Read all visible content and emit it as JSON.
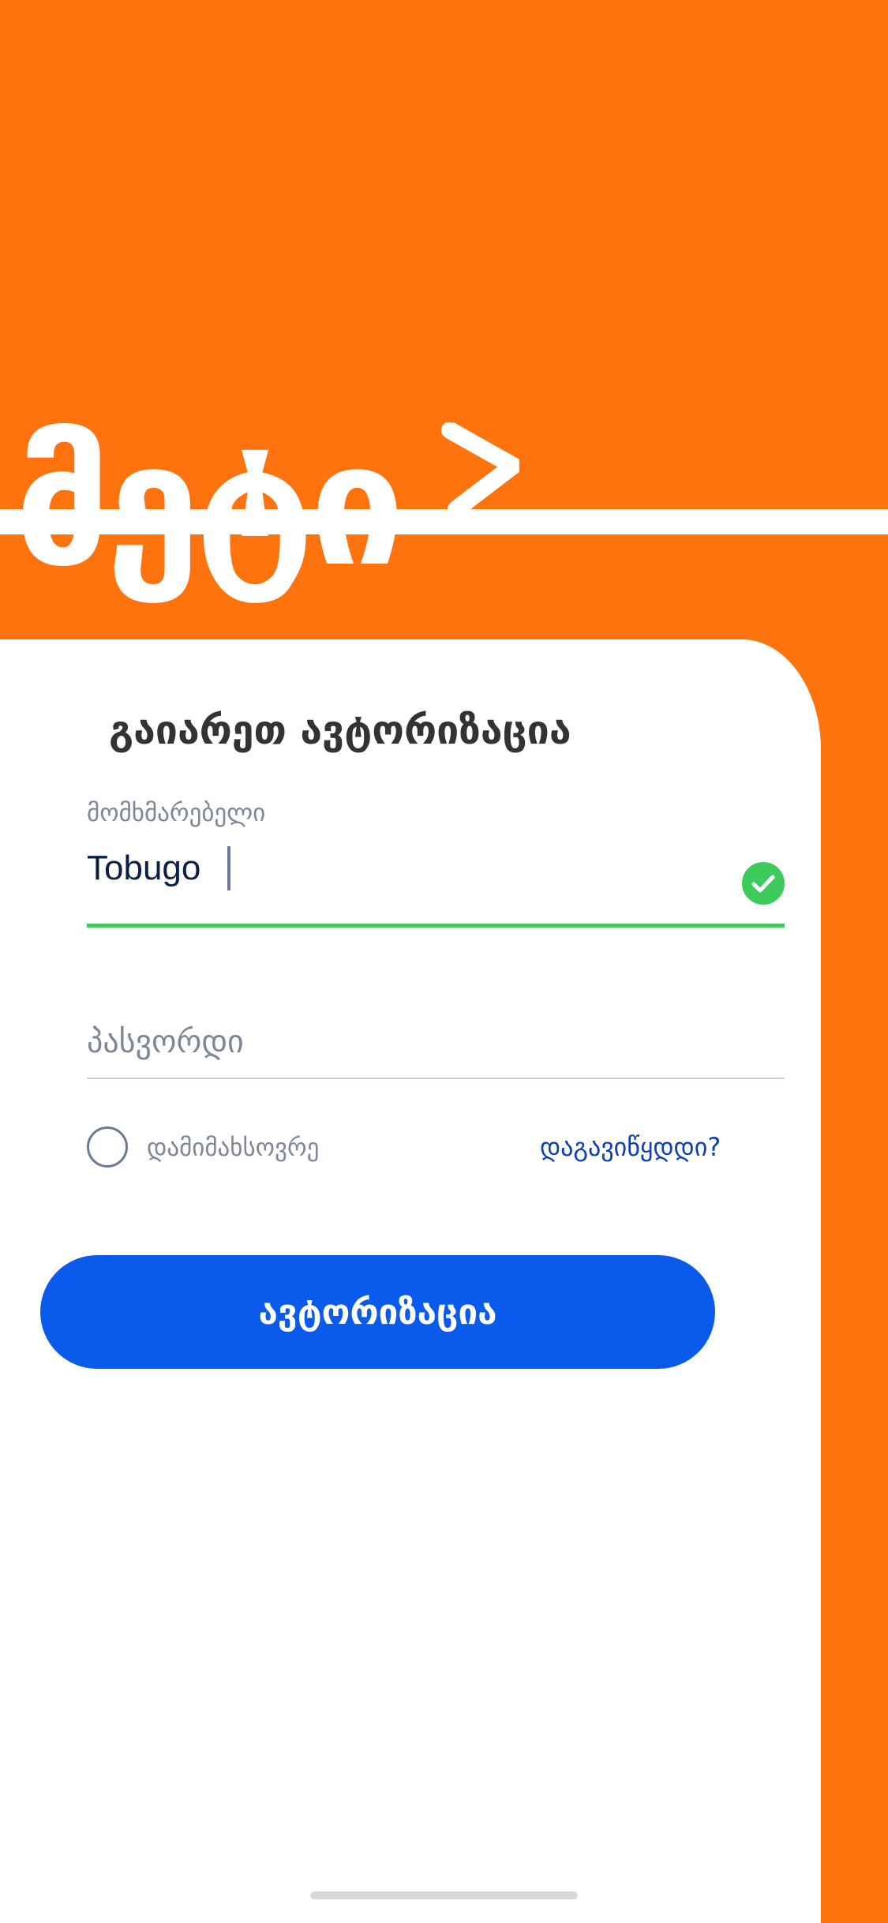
{
  "brand": {
    "logo_text": "მეტი",
    "logo_mark_icon": "chevron-right-icon"
  },
  "login": {
    "title": "გაიარეთ ავტორიზაცია",
    "username": {
      "label": "მომხმარებელი",
      "value": "Tobugo",
      "valid_icon": "check-circle-icon"
    },
    "password": {
      "placeholder": "პასვორდი"
    },
    "remember_me": {
      "label": "დამიმახსოვრე",
      "checked": false
    },
    "forgot_password": {
      "label": "დაგავიწყდდი?"
    },
    "submit_label": "ავტორიზაცია"
  },
  "colors": {
    "brand_orange": "#FF730F",
    "primary_blue": "#0A5BEB",
    "link_blue": "#0E3FB7",
    "success_green": "#3DCB5B",
    "text_dark": "#0A1F44",
    "text_muted": "#7D8796"
  }
}
